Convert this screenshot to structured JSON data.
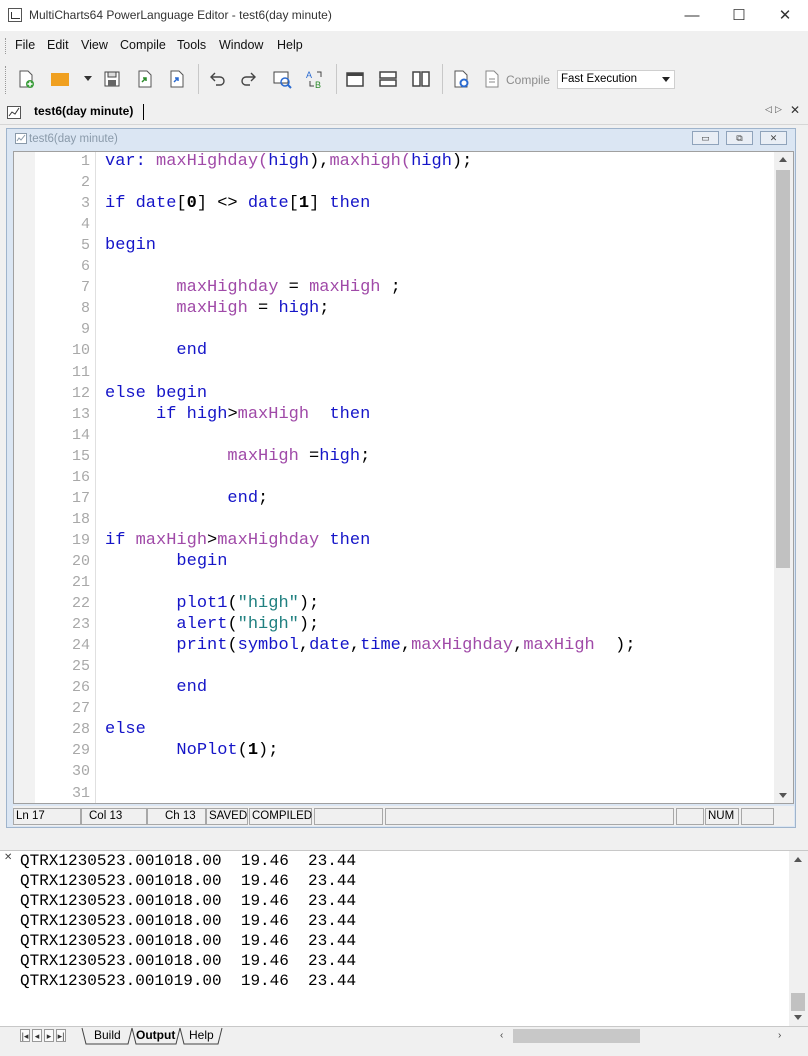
{
  "window": {
    "title": "MultiCharts64 PowerLanguage Editor - test6(day minute)",
    "minimize_glyph": "—",
    "maximize_glyph": "☐",
    "close_glyph": "✕"
  },
  "menu": [
    "File",
    "Edit",
    "View",
    "Compile",
    "Tools",
    "Window",
    "Help"
  ],
  "toolbar": {
    "compile_label": "Compile",
    "execution_mode": "Fast Execution"
  },
  "doc_tab": {
    "label": "test6(day minute)"
  },
  "mdi": {
    "title": "test6(day minute)"
  },
  "editor": {
    "lines": [
      [
        {
          "t": "var: ",
          "c": "kw"
        },
        {
          "t": "maxHighday",
          "c": "fn"
        },
        {
          "t": "(",
          "c": "fn"
        },
        {
          "t": "high",
          "c": "kw"
        },
        {
          "t": "),",
          "c": ""
        },
        {
          "t": "maxhigh",
          "c": "fn"
        },
        {
          "t": "(",
          "c": "fn"
        },
        {
          "t": "high",
          "c": "kw"
        },
        {
          "t": ");",
          "c": ""
        }
      ],
      [],
      [
        {
          "t": "if ",
          "c": "kw"
        },
        {
          "t": "date",
          "c": "kw"
        },
        {
          "t": "[",
          "c": ""
        },
        {
          "t": "0",
          "c": "num"
        },
        {
          "t": "] <> ",
          "c": ""
        },
        {
          "t": "date",
          "c": "kw"
        },
        {
          "t": "[",
          "c": ""
        },
        {
          "t": "1",
          "c": "num"
        },
        {
          "t": "] ",
          "c": ""
        },
        {
          "t": "then",
          "c": "kw"
        }
      ],
      [],
      [
        {
          "t": "begin",
          "c": "kw"
        }
      ],
      [],
      [
        {
          "t": "       ",
          "c": ""
        },
        {
          "t": "maxHighday",
          "c": "fn"
        },
        {
          "t": " = ",
          "c": ""
        },
        {
          "t": "maxHigh",
          "c": "fn"
        },
        {
          "t": " ;",
          "c": ""
        }
      ],
      [
        {
          "t": "       ",
          "c": ""
        },
        {
          "t": "maxHigh",
          "c": "fn"
        },
        {
          "t": " = ",
          "c": ""
        },
        {
          "t": "high",
          "c": "kw"
        },
        {
          "t": ";",
          "c": ""
        }
      ],
      [],
      [
        {
          "t": "       ",
          "c": ""
        },
        {
          "t": "end",
          "c": "kw"
        }
      ],
      [],
      [
        {
          "t": "else begin",
          "c": "kw"
        }
      ],
      [
        {
          "t": "     ",
          "c": ""
        },
        {
          "t": "if ",
          "c": "kw"
        },
        {
          "t": "high",
          "c": "kw"
        },
        {
          "t": ">",
          "c": ""
        },
        {
          "t": "maxHigh",
          "c": "fn"
        },
        {
          "t": "  ",
          "c": ""
        },
        {
          "t": "then",
          "c": "kw"
        }
      ],
      [],
      [
        {
          "t": "            ",
          "c": ""
        },
        {
          "t": "maxHigh",
          "c": "fn"
        },
        {
          "t": " =",
          "c": ""
        },
        {
          "t": "high",
          "c": "kw"
        },
        {
          "t": ";",
          "c": ""
        }
      ],
      [],
      [
        {
          "t": "            ",
          "c": ""
        },
        {
          "t": "end",
          "c": "kw"
        },
        {
          "t": ";",
          "c": ""
        }
      ],
      [],
      [
        {
          "t": "if ",
          "c": "kw"
        },
        {
          "t": "maxHigh",
          "c": "fn"
        },
        {
          "t": ">",
          "c": ""
        },
        {
          "t": "maxHighday",
          "c": "fn"
        },
        {
          "t": " ",
          "c": ""
        },
        {
          "t": "then",
          "c": "kw"
        }
      ],
      [
        {
          "t": "       ",
          "c": ""
        },
        {
          "t": "begin",
          "c": "kw"
        }
      ],
      [],
      [
        {
          "t": "       ",
          "c": ""
        },
        {
          "t": "plot1",
          "c": "kw"
        },
        {
          "t": "(",
          "c": ""
        },
        {
          "t": "\"high\"",
          "c": "str"
        },
        {
          "t": ");",
          "c": ""
        }
      ],
      [
        {
          "t": "       ",
          "c": ""
        },
        {
          "t": "alert",
          "c": "kw"
        },
        {
          "t": "(",
          "c": ""
        },
        {
          "t": "\"high\"",
          "c": "str"
        },
        {
          "t": ");",
          "c": ""
        }
      ],
      [
        {
          "t": "       ",
          "c": ""
        },
        {
          "t": "print",
          "c": "kw"
        },
        {
          "t": "(",
          "c": ""
        },
        {
          "t": "symbol",
          "c": "kw"
        },
        {
          "t": ",",
          "c": ""
        },
        {
          "t": "date",
          "c": "kw"
        },
        {
          "t": ",",
          "c": ""
        },
        {
          "t": "time",
          "c": "kw"
        },
        {
          "t": ",",
          "c": ""
        },
        {
          "t": "maxHighday",
          "c": "fn"
        },
        {
          "t": ",",
          "c": ""
        },
        {
          "t": "maxHigh",
          "c": "fn"
        },
        {
          "t": "  );",
          "c": ""
        }
      ],
      [],
      [
        {
          "t": "       ",
          "c": ""
        },
        {
          "t": "end",
          "c": "kw"
        }
      ],
      [],
      [
        {
          "t": "else",
          "c": "kw"
        }
      ],
      [
        {
          "t": "       ",
          "c": ""
        },
        {
          "t": "NoPlot",
          "c": "kw"
        },
        {
          "t": "(",
          "c": ""
        },
        {
          "t": "1",
          "c": "num"
        },
        {
          "t": ");",
          "c": ""
        }
      ],
      [],
      []
    ]
  },
  "statusbar": {
    "line": "Ln 17",
    "col": "Col 13",
    "ch": "Ch 13",
    "saved": "SAVED",
    "compiled": "COMPILED",
    "num": "NUM"
  },
  "output": {
    "lines": [
      "QTRX1230523.001018.00  19.46  23.44",
      "QTRX1230523.001018.00  19.46  23.44",
      "QTRX1230523.001018.00  19.46  23.44",
      "QTRX1230523.001018.00  19.46  23.44",
      "QTRX1230523.001018.00  19.46  23.44",
      "QTRX1230523.001018.00  19.46  23.44",
      "QTRX1230523.001019.00  19.46  23.44"
    ]
  },
  "bottom_tabs": [
    "Build",
    "Output",
    "Help"
  ],
  "colors": {
    "keyword": "#1515c8",
    "identifier": "#a04aa8",
    "string": "#208080"
  }
}
